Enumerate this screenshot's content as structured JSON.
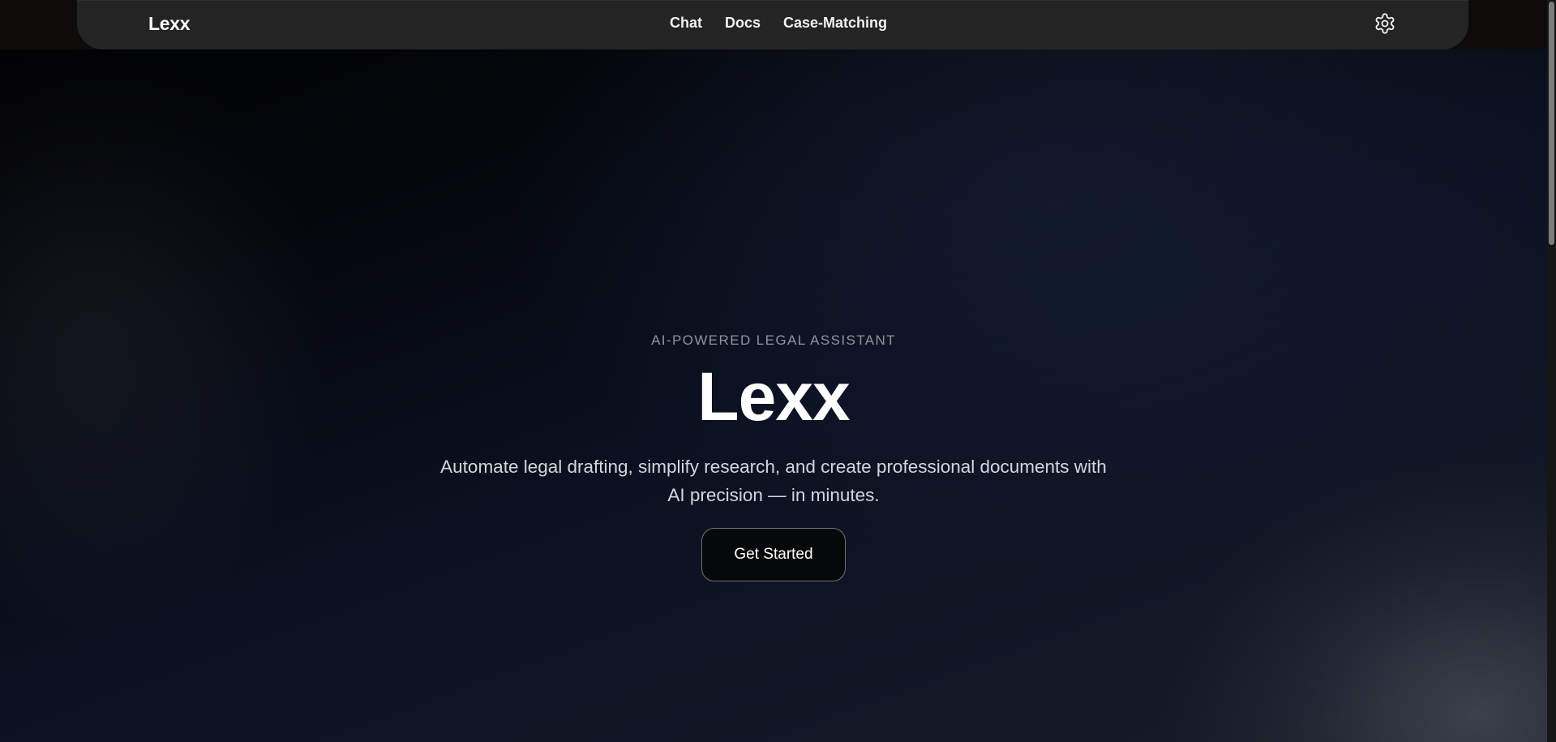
{
  "nav": {
    "brand": "Lexx",
    "links": [
      {
        "label": "Chat"
      },
      {
        "label": "Docs"
      },
      {
        "label": "Case-Matching"
      }
    ],
    "settings_icon": "gear-icon"
  },
  "hero": {
    "eyebrow": "AI-POWERED LEGAL ASSISTANT",
    "title": "Lexx",
    "tagline": "Automate legal drafting, simplify research, and create professional documents with AI precision — in minutes.",
    "cta_label": "Get Started"
  },
  "colors": {
    "background": "#05070c",
    "navbar": "#242424",
    "text": "#ffffff",
    "muted": "#8d93a0"
  }
}
